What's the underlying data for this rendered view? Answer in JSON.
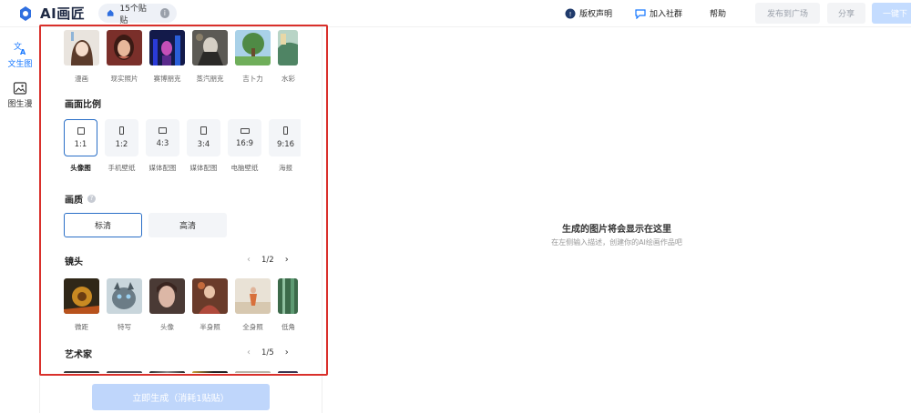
{
  "app": {
    "title": "AI画匠"
  },
  "credits": {
    "label": "15个贴贴"
  },
  "topbar": {
    "copyright": "版权声明",
    "community": "加入社群",
    "help": "帮助",
    "publish": "发布到广场",
    "share": "分享",
    "download": "一键下"
  },
  "sidenav": [
    {
      "label": "文生图",
      "active": true,
      "icon": "translate-icon"
    },
    {
      "label": "图生漫",
      "active": false,
      "icon": "image-icon"
    }
  ],
  "styles": [
    "漫画",
    "现实照片",
    "赛博朋克",
    "蒸汽朋克",
    "吉卜力",
    "水彩"
  ],
  "ratio": {
    "title": "画面比例",
    "items": [
      {
        "value": "1:1",
        "label": "头像图",
        "active": true
      },
      {
        "value": "1:2",
        "label": "手机壁纸",
        "active": false
      },
      {
        "value": "4:3",
        "label": "媒体配图",
        "active": false
      },
      {
        "value": "3:4",
        "label": "媒体配图",
        "active": false
      },
      {
        "value": "16:9",
        "label": "电脑壁纸",
        "active": false
      },
      {
        "value": "9:16",
        "label": "海报",
        "active": false
      }
    ]
  },
  "quality": {
    "title": "画质",
    "options": [
      {
        "label": "标清",
        "active": true
      },
      {
        "label": "高清",
        "active": false
      }
    ]
  },
  "shot": {
    "title": "镜头",
    "page": "1/2",
    "items": [
      "微距",
      "特写",
      "头像",
      "半身照",
      "全身照",
      "低角"
    ]
  },
  "artist": {
    "title": "艺术家",
    "page": "1/5"
  },
  "generate": {
    "label": "立即生成（消耗1贴贴）"
  },
  "preview": {
    "title": "生成的图片将会显示在这里",
    "subtitle": "在左侧输入描述，创建你的AI绘画作品吧"
  },
  "colors": {
    "accent": "#1677ff",
    "highlight": "#d9302b",
    "selected_border": "#2a6fc7"
  }
}
